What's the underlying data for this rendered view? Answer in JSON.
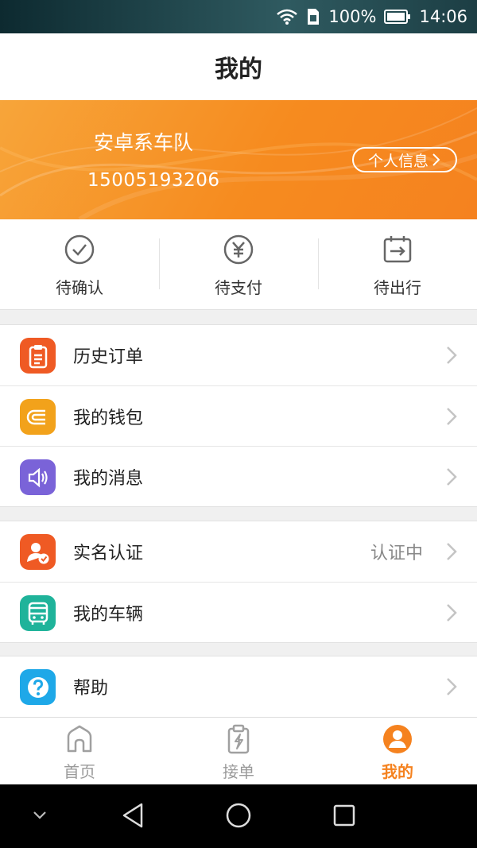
{
  "status_bar": {
    "battery": "100%",
    "time": "14:06"
  },
  "header": {
    "title": "我的"
  },
  "profile": {
    "name": "安卓系车队",
    "phone": "15005193206",
    "info_button": "个人信息"
  },
  "quick_actions": [
    {
      "label": "待确认",
      "icon": "check-circle-icon"
    },
    {
      "label": "待支付",
      "icon": "yuan-circle-icon"
    },
    {
      "label": "待出行",
      "icon": "calendar-arrow-icon"
    }
  ],
  "menu_groups": [
    {
      "items": [
        {
          "label": "历史订单",
          "icon": "clipboard-icon",
          "color": "#ef5a24"
        },
        {
          "label": "我的钱包",
          "icon": "wallet-icon",
          "color": "#f2a21b"
        },
        {
          "label": "我的消息",
          "icon": "speaker-icon",
          "color": "#7a63d8"
        }
      ]
    },
    {
      "items": [
        {
          "label": "实名认证",
          "icon": "user-verified-icon",
          "color": "#ef5a24",
          "status": "认证中"
        },
        {
          "label": "我的车辆",
          "icon": "bus-icon",
          "color": "#1fb39a"
        }
      ]
    },
    {
      "items": [
        {
          "label": "帮助",
          "icon": "help-icon",
          "color": "#1ea8e8"
        }
      ]
    }
  ],
  "tabbar": [
    {
      "label": "首页",
      "icon": "home-icon",
      "active": false
    },
    {
      "label": "接单",
      "icon": "clipboard-bolt-icon",
      "active": false
    },
    {
      "label": "我的",
      "icon": "user-icon",
      "active": true
    }
  ],
  "colors": {
    "accent": "#f5821f",
    "profile_bg": "#f68b1f"
  }
}
